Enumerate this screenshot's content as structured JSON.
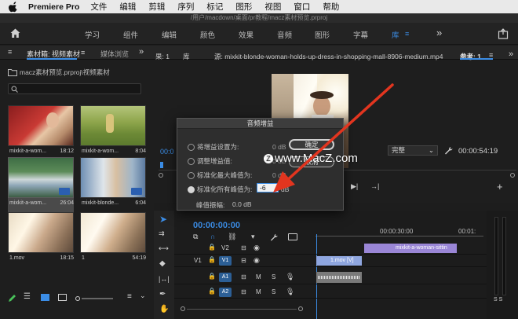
{
  "menubar": {
    "app": "Premiere Pro",
    "items": [
      "文件",
      "编辑",
      "剪辑",
      "序列",
      "标记",
      "图形",
      "视图",
      "窗口",
      "帮助"
    ]
  },
  "path": "/用户/macdown/桌面/pr教程/macz素材预览.prproj",
  "workspaces": {
    "items": [
      "学习",
      "组件",
      "编辑",
      "颜色",
      "效果",
      "音频",
      "图形",
      "字幕"
    ],
    "active": "库"
  },
  "project": {
    "tab_label": "素材箱: 视频素材",
    "tab2_label": "媒体浏览",
    "path": "macz素材预览.prproj\\视频素材",
    "clips": [
      {
        "name": "mixkit-a-wom...",
        "duration": "18:12"
      },
      {
        "name": "mixkit-a-wom...",
        "duration": "8:04"
      },
      {
        "name": "mixkit-a-wom...",
        "duration": "26:04"
      },
      {
        "name": "mixkit-blonde...",
        "duration": "6:04"
      },
      {
        "name": "1.mov",
        "duration": "18:15"
      },
      {
        "name": "1",
        "duration": "54:19"
      }
    ]
  },
  "source": {
    "left_label": "果: 1",
    "lib_label": "库",
    "source_title": "源: mixkit-blonde-woman-holds-up-dress-in-shopping-mall-8906-medium.mp4",
    "ref_label": "参考: 1",
    "timecode_left": "00:0",
    "fit_value": "完整",
    "timecode_right": "00:00:54:19"
  },
  "timeline": {
    "timecode": "00:00:00:00",
    "ruler_mid": "00:00:30:00",
    "ruler_end": "00:01:",
    "tracks": [
      {
        "label": "V2",
        "btn": "V2"
      },
      {
        "label": "V1",
        "btn": "V1"
      },
      {
        "label": "",
        "btn": "A1"
      },
      {
        "label": "",
        "btn": "A2"
      }
    ],
    "clip_v2": "mixkit-a-woman-sittin",
    "clip_v1": "1.mov [V]",
    "mute_label": "M",
    "solo_label": "S",
    "meter_labels": "S S"
  },
  "dialog": {
    "title": "音频增益",
    "options": [
      {
        "label": "将增益设置为:",
        "value": "0 dB"
      },
      {
        "label": "调整增益值:",
        "value": "0 dB"
      },
      {
        "label": "标准化最大峰值为:",
        "value": "0 dB"
      },
      {
        "label": "标准化所有峰值为:",
        "value": "-6",
        "unit": "dB"
      }
    ],
    "peak_label": "峰值振幅:",
    "peak_value": "0.0 dB",
    "ok_label": "确定",
    "cancel_label": "取消"
  },
  "watermark": "www.MacZ.com",
  "colors": {
    "accent": "#3b8de6",
    "arrow": "#e2351f",
    "clip_purple": "#9a86d6",
    "clip_blue_light": "#8fa6df"
  }
}
